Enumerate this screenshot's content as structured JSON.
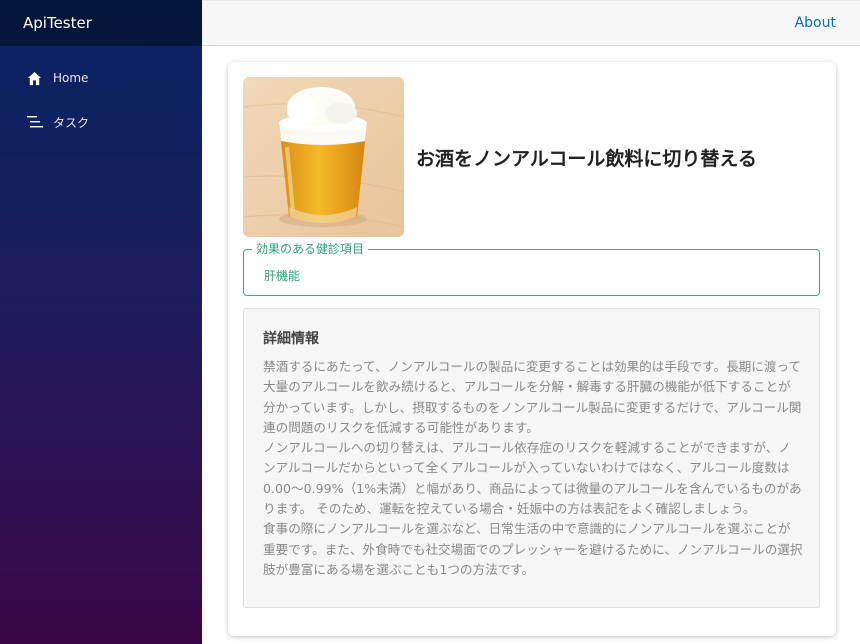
{
  "app": {
    "title": "ApiTester"
  },
  "sidebar": {
    "items": [
      {
        "label": "Home",
        "icon": "home-icon"
      },
      {
        "label": "タスク",
        "icon": "list-icon"
      }
    ]
  },
  "topbar": {
    "about_label": "About"
  },
  "task": {
    "title": "お酒をノンアルコール飲料に切り替える",
    "image": "beer-glass-image",
    "fieldset": {
      "legend": "効果のある健診項目",
      "value": "肝機能"
    },
    "detail": {
      "heading": "詳細情報",
      "paragraphs": [
        "禁酒するにあたって、ノンアルコールの製品に変更することは効果的は手段です。長期に渡って大量のアルコールを飲み続けると、アルコールを分解・解毒する肝臓の機能が低下することが分かっています。しかし、摂取するものをノンアルコール製品に変更するだけで、アルコール関連の問題のリスクを低減する可能性があります。",
        "ノンアルコールへの切り替えは、アルコール依存症のリスクを軽減することができますが、ノンアルコールだからといって全くアルコールが入っていないわけではなく、アルコール度数は0.00〜0.99%（1%未満）と幅があり、商品によっては微量のアルコールを含んでいるものがあります。 そのため、運転を控えている場合・妊娠中の方は表記をよく確認しましょう。",
        "食事の際にノンアルコールを選ぶなど、日常生活の中で意識的にノンアルコールを選ぶことが重要です。また、外食時でも社交場面でのプレッシャーを避けるために、ノンアルコールの選択肢が豊富にある場を選ぶことも1つの方法です。"
      ]
    }
  },
  "colors": {
    "sidebar_top": "#072463",
    "sidebar_bottom": "#3a0647",
    "link": "#0b6ab3",
    "accent_green": "#2f9e7a"
  }
}
